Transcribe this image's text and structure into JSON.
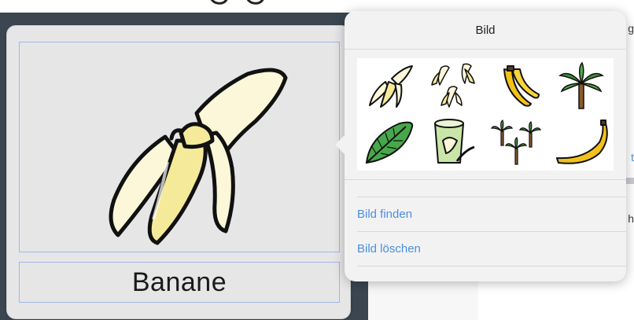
{
  "card": {
    "label": "Banane",
    "image_icon": "peeled-banana-icon"
  },
  "popover": {
    "title": "Bild",
    "images": [
      {
        "name": "peeled-banana-small-icon"
      },
      {
        "name": "three-peeled-bananas-icon"
      },
      {
        "name": "banana-bunch-icon"
      },
      {
        "name": "banana-tree-icon"
      },
      {
        "name": "banana-leaf-icon"
      },
      {
        "name": "banana-yogurt-icon"
      },
      {
        "name": "banana-trees-icon"
      },
      {
        "name": "whole-banana-icon"
      }
    ],
    "actions": {
      "find_image": "Bild finden",
      "delete_image": "Bild löschen"
    }
  },
  "background": {
    "cut_text_1": "g",
    "cut_text_2": "t",
    "cut_text_3": "h"
  },
  "colors": {
    "accent": "#4a8fde",
    "card_bg": "#e6e6e6",
    "popover_bg": "#f2f2f3",
    "dark_bg": "#3b4650"
  }
}
